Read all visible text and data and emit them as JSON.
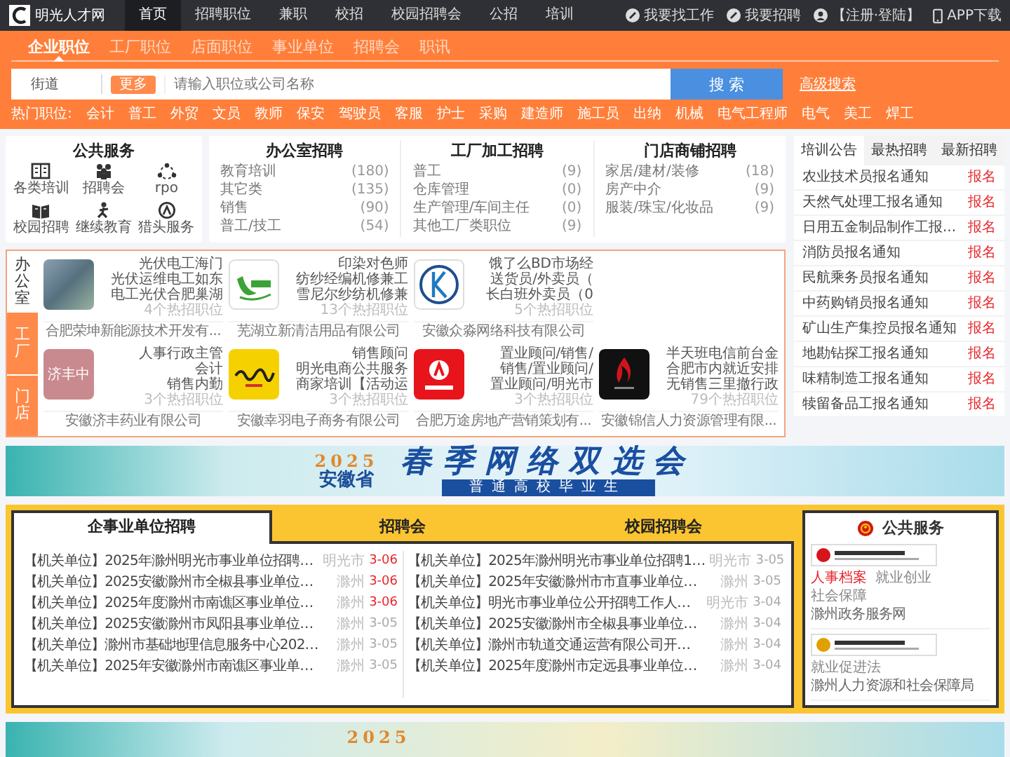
{
  "nav": {
    "logo_text": "明光人才网",
    "items": [
      {
        "label": "首页",
        "selected": true
      },
      {
        "label": "招聘职位",
        "selected": false
      },
      {
        "label": "兼职",
        "selected": false
      },
      {
        "label": "校招",
        "selected": false
      },
      {
        "label": "校园招聘会",
        "selected": false
      },
      {
        "label": "公招",
        "selected": false
      },
      {
        "label": "培训",
        "selected": false
      }
    ],
    "actions": [
      {
        "label": "我要找工作",
        "kind": "pen"
      },
      {
        "label": "我要招聘",
        "kind": "pen"
      },
      {
        "label": "【注册·登陆】",
        "kind": "user"
      },
      {
        "label": "APP下载",
        "kind": "phone"
      }
    ]
  },
  "search_tabs": [
    {
      "label": "企业职位",
      "selected": true
    },
    {
      "label": "工厂职位",
      "selected": false
    },
    {
      "label": "店面职位",
      "selected": false
    },
    {
      "label": "事业单位",
      "selected": false
    },
    {
      "label": "招聘会",
      "selected": false
    },
    {
      "label": "职讯",
      "selected": false
    }
  ],
  "search": {
    "location": "街道",
    "badge": "更多",
    "placeholder": "请输入职位或公司名称",
    "button": "搜 索",
    "advanced_link": "高级搜索"
  },
  "hot_jobs": {
    "label": "热门职位:",
    "items": [
      "会计",
      "普工",
      "外贸",
      "文员",
      "教师",
      "保安",
      "驾驶员",
      "客服",
      "护士",
      "采购",
      "建造师",
      "施工员",
      "出纳",
      "机械",
      "电气工程师",
      "电气",
      "美工",
      "焊工"
    ]
  },
  "public_services": {
    "title": "公共服务",
    "items": [
      {
        "label": "各类培训",
        "kind": "book"
      },
      {
        "label": "招聘会",
        "kind": "people"
      },
      {
        "label": "rpo",
        "kind": "dots"
      },
      {
        "label": "校园招聘",
        "kind": "open-book"
      },
      {
        "label": "继续教育",
        "kind": "person"
      },
      {
        "label": "猎头服务",
        "kind": "badge"
      }
    ]
  },
  "job_categories": [
    {
      "title": "办公室招聘",
      "items": [
        {
          "name": "教育培训",
          "count": "(180)"
        },
        {
          "name": "其它类",
          "count": "(135)"
        },
        {
          "name": "销售",
          "count": "(90)"
        },
        {
          "name": "普工/技工",
          "count": "(54)"
        }
      ]
    },
    {
      "title": "工厂加工招聘",
      "items": [
        {
          "name": "普工",
          "count": "(9)"
        },
        {
          "name": "仓库管理",
          "count": "(0)"
        },
        {
          "name": "生产管理/车间主任",
          "count": "(0)"
        },
        {
          "name": "其他工厂类职位",
          "count": "(9)"
        }
      ]
    },
    {
      "title": "门店商铺招聘",
      "items": [
        {
          "name": "家居/建材/装修",
          "count": "(18)"
        },
        {
          "name": "房产中介",
          "count": "(9)"
        },
        {
          "name": "服装/珠宝/化妆品",
          "count": "(9)"
        }
      ]
    }
  ],
  "notices": {
    "tabs": [
      {
        "label": "培训公告",
        "selected": true
      },
      {
        "label": "最热招聘",
        "selected": false
      },
      {
        "label": "最新招聘",
        "selected": false
      }
    ],
    "items": [
      {
        "title": "农业技术员报名通知",
        "action": "报名"
      },
      {
        "title": "天然气处理工报名通知",
        "action": "报名"
      },
      {
        "title": "日用五金制品制作工报...",
        "action": "报名"
      },
      {
        "title": "消防员报名通知",
        "action": "报名"
      },
      {
        "title": "民航乘务员报名通知",
        "action": "报名"
      },
      {
        "title": "中药购销员报名通知",
        "action": "报名"
      },
      {
        "title": "矿山生产集控员报名通知",
        "action": "报名"
      },
      {
        "title": "地勘钻探工报名通知",
        "action": "报名"
      },
      {
        "title": "味精制造工报名通知",
        "action": "报名"
      },
      {
        "title": "犊留备品工报名通知",
        "action": "报名"
      }
    ]
  },
  "companies": {
    "side_tabs": [
      {
        "label": "办公室",
        "selected": true
      },
      {
        "label": "工厂",
        "selected": false
      },
      {
        "label": "门店",
        "selected": false
      }
    ],
    "rows": [
      [
        {
          "kind": "photo",
          "jobs": [
            "光伏电工海门",
            "光伏运维电工如东",
            "电工光伏合肥巢湖"
          ],
          "hot": "4个热招职位",
          "name": "合肥荣坤新能源技术开发有..."
        },
        {
          "kind": "leaf",
          "jobs": [
            "印染对色师",
            "纺纱经编机修兼工",
            "雪尼尔纱纺机修兼"
          ],
          "hot": "13个热招职位",
          "name": "芜湖立新清洁用品有限公司"
        },
        {
          "kind": "ring",
          "jobs": [
            "饿了么BD市场经",
            "送货员/外卖员（",
            "长白班外卖员（0"
          ],
          "hot": "5个热招职位",
          "name": "安徽众淼网络科技有限公司"
        }
      ],
      [
        {
          "kind": "text",
          "logo_text": "济丰中",
          "jobs": [
            "人事行政主管",
            "会计",
            "销售内勤"
          ],
          "hot": "3个热招职位",
          "name": "安徽济丰药业有限公司"
        },
        {
          "kind": "yellow",
          "jobs": [
            "销售顾问",
            "明光电商公共服务",
            "商家培训【活动运"
          ],
          "hot": "3个热招职位",
          "name": "安徽幸羽电子商务有限公司"
        },
        {
          "kind": "red",
          "jobs": [
            "置业顾问/销售/",
            "销售/置业顾问/",
            "置业顾问/明光市"
          ],
          "hot": "3个热招职位",
          "name": "合肥万途房地产营销策划有..."
        },
        {
          "kind": "dark",
          "jobs": [
            "半天班电信前台金",
            "合肥市内就近安排",
            "无销售三里撤行政"
          ],
          "hot": "79个热招职位",
          "name": "安徽锦信人力资源管理有限..."
        }
      ]
    ]
  },
  "banner": {
    "year": "2025",
    "region": "安徽省",
    "title": "春季网络双选会",
    "subtitle": "普通高校毕业生"
  },
  "recruit": {
    "tabs": [
      {
        "label": "企事业单位招聘",
        "selected": true
      },
      {
        "label": "招聘会",
        "selected": false
      },
      {
        "label": "校园招聘会",
        "selected": false
      }
    ],
    "columns": [
      [
        {
          "title": "【机关单位】2025年滁州明光市事业单位招聘…",
          "city": "明光市",
          "date": "3-06",
          "new": true
        },
        {
          "title": "【机关单位】2025安徽滁州市全椒县事业单位…",
          "city": "滁州",
          "date": "3-06",
          "new": true
        },
        {
          "title": "【机关单位】2025年度滁州市南谯区事业单位…",
          "city": "滁州",
          "date": "3-06",
          "new": true
        },
        {
          "title": "【机关单位】2025安徽滁州市凤阳县事业单位…",
          "city": "滁州",
          "date": "3-05",
          "new": false
        },
        {
          "title": "【机关单位】滁州市基础地理信息服务中心202…",
          "city": "滁州",
          "date": "3-05",
          "new": false
        },
        {
          "title": "【机关单位】2025年安徽滁州市南谯区事业单…",
          "city": "滁州",
          "date": "3-05",
          "new": false
        }
      ],
      [
        {
          "title": "【机关单位】2025年滁州明光市事业单位招聘1…",
          "city": "明光市",
          "date": "3-05",
          "new": false
        },
        {
          "title": "【机关单位】2025年安徽滁州市市直事业单位…",
          "city": "滁州",
          "date": "3-05",
          "new": false
        },
        {
          "title": "【机关单位】明光市事业单位公开招聘工作人…",
          "city": "明光市",
          "date": "3-04",
          "new": false
        },
        {
          "title": "【机关单位】2025安徽滁州市全椒县事业单位…",
          "city": "滁州",
          "date": "3-04",
          "new": false
        },
        {
          "title": "【机关单位】滁州市轨道交通运营有限公司开…",
          "city": "滁州",
          "date": "3-04",
          "new": false
        },
        {
          "title": "【机关单位】2025年度滁州市定远县事业单位…",
          "city": "滁州",
          "date": "3-04",
          "new": false
        }
      ]
    ]
  },
  "gov_services": {
    "title": "公共服务",
    "entries": [
      {
        "links": [
          {
            "label": "人事档案",
            "highlight": true
          },
          {
            "label": "就业创业",
            "highlight": false
          },
          {
            "label": "社会保障",
            "highlight": false
          }
        ],
        "name": "滁州政务服务网"
      },
      {
        "links": [
          {
            "label": "就业促进法",
            "highlight": false
          }
        ],
        "name": "滁州人力资源和社会保障局"
      }
    ]
  },
  "bottom_banner": {
    "year": "2025"
  }
}
